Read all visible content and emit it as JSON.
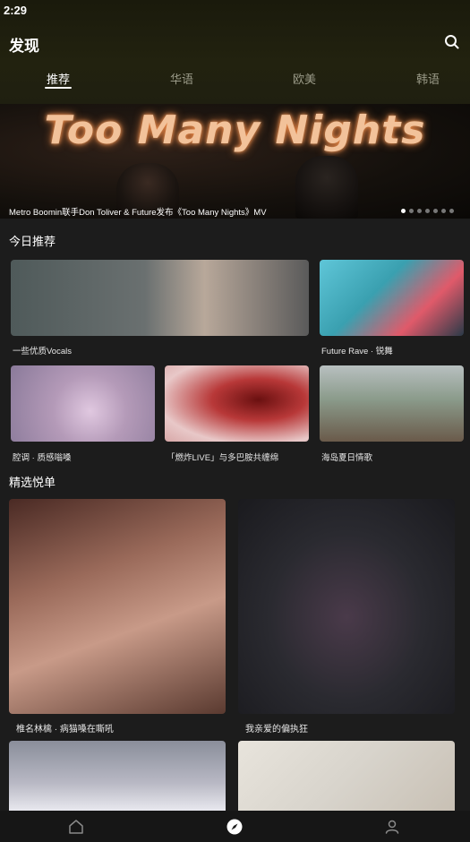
{
  "status_bar": {
    "time": "2:29"
  },
  "header": {
    "title": "发现",
    "search_icon": "search-icon"
  },
  "tabs": [
    {
      "label": "推荐",
      "active": true
    },
    {
      "label": "华语",
      "active": false
    },
    {
      "label": "欧美",
      "active": false
    },
    {
      "label": "韩语",
      "active": false
    }
  ],
  "banner": {
    "title": "Too Many Nights",
    "caption": "Metro Boomin联手Don Toliver & Future发布《Too Many Nights》MV",
    "dots_total": 7,
    "active_dot": 1
  },
  "today": {
    "title": "今日推荐",
    "items": [
      {
        "label": "一些优质Vocals",
        "color": "#5a6868"
      },
      {
        "label": "Future Rave · 锐舞",
        "color": "#5fc6d8"
      },
      {
        "label": "腔调 · 质感嗡嗓",
        "color": "#b49ab8"
      },
      {
        "label": "「燃炸LIVE」与多巴胺共缠绵",
        "color": "#b83838"
      },
      {
        "label": "海岛夏日情歌",
        "color": "#8a9a8a"
      }
    ]
  },
  "featured": {
    "title": "精选悦单",
    "items": [
      {
        "label": "椎名林檎 · 病猫嗓在嘶吼",
        "color": "#9a6a5a"
      },
      {
        "label": "我亲爱的偏执狂",
        "color": "#2a2a30"
      },
      {
        "label": "",
        "color": "#8a8e9a"
      },
      {
        "label": "",
        "color": "#d8d4cc"
      }
    ]
  },
  "bottom_nav": [
    {
      "name": "home-icon",
      "active": false
    },
    {
      "name": "discover-compass-icon",
      "active": true
    },
    {
      "name": "profile-icon",
      "active": false
    }
  ]
}
